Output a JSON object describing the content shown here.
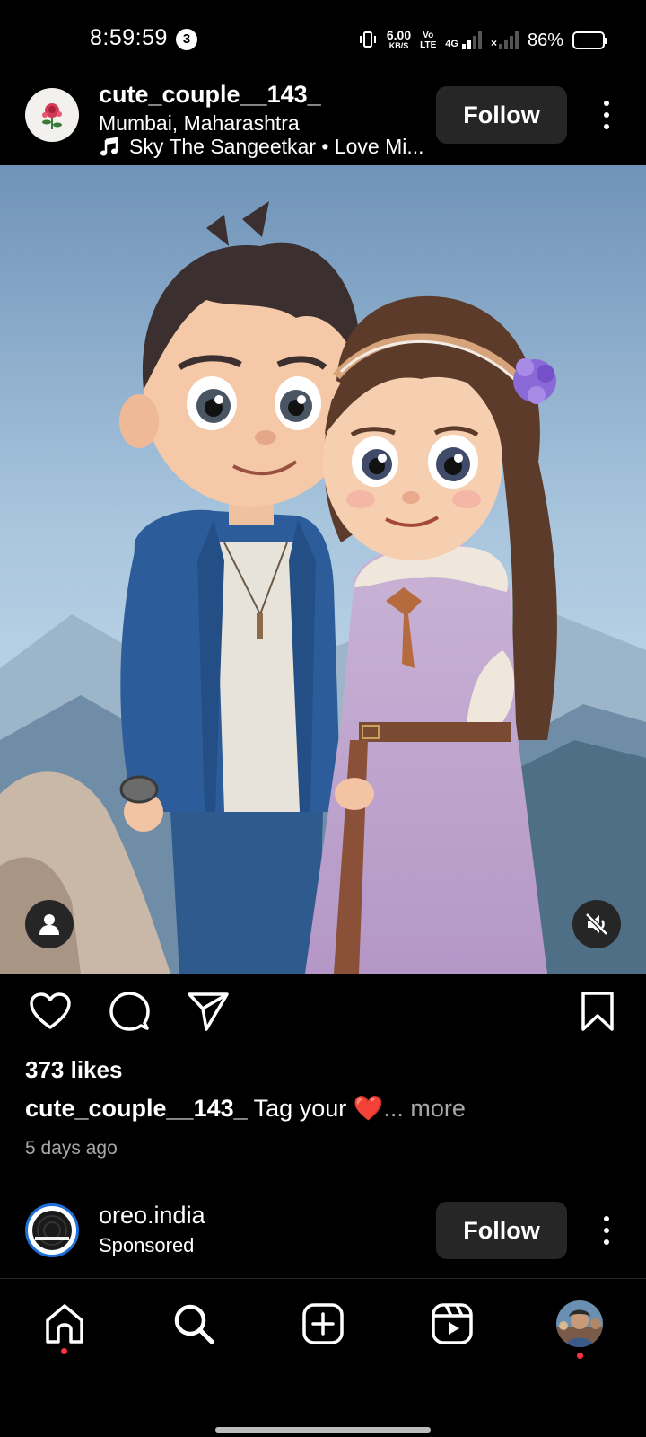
{
  "status_bar": {
    "time": "8:59:59",
    "notification_count": "3",
    "net_speed": "6.00",
    "net_unit": "KB/S",
    "volte_top": "Vo",
    "volte_bottom": "LTE",
    "network_type": "4G",
    "battery": "86%",
    "battery_level": 0.86
  },
  "post": {
    "username": "cute_couple__143_",
    "location": "Mumbai, Maharashtra",
    "music": "Sky The Sangeetkar • Love Mi...",
    "follow_label": "Follow",
    "likes": "373 likes",
    "caption_user": "cute_couple__143_",
    "caption_text": "Tag your",
    "caption_emoji": "❤️",
    "caption_more": "... more",
    "timestamp": "5 days ago"
  },
  "sponsored": {
    "username": "oreo.india",
    "label": "Sponsored",
    "follow_label": "Follow"
  },
  "nav": {
    "items": [
      "home-icon",
      "search-icon",
      "create-icon",
      "reels-icon",
      "profile"
    ]
  },
  "colors": {
    "background": "#000000",
    "button_bg": "#262626",
    "muted_text": "#a8a8a8",
    "notification_dot": "#ff3040",
    "story_ring": "#1e6fd9"
  }
}
